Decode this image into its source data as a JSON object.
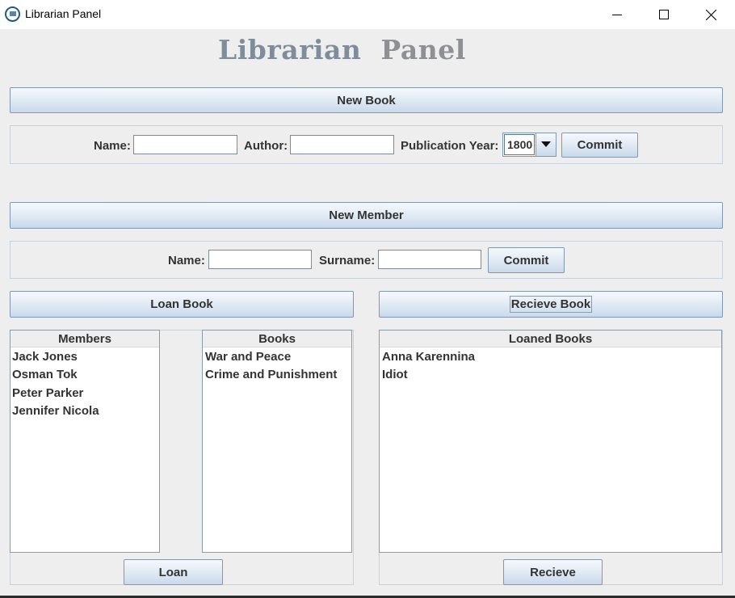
{
  "window": {
    "title": "Librarian Panel",
    "icon": "library-app-icon",
    "icon_text": "IIII"
  },
  "heading": {
    "word1": "Librarian",
    "word2": "Panel"
  },
  "new_book": {
    "section_label": "New Book",
    "name_label": "Name:",
    "name_value": "",
    "author_label": "Author:",
    "author_value": "",
    "year_label": "Publication Year:",
    "year_selected": "1800",
    "commit_label": "Commit"
  },
  "new_member": {
    "section_label": "New Member",
    "name_label": "Name:",
    "name_value": "",
    "surname_label": "Surname:",
    "surname_value": "",
    "commit_label": "Commit"
  },
  "loan_book": {
    "section_label": "Loan Book",
    "members_header": "Members",
    "members": [
      "Jack Jones",
      "Osman Tok",
      "Peter Parker",
      "Jennifer Nicola"
    ],
    "books_header": "Books",
    "books": [
      "War and Peace",
      "Crime and Punishment"
    ],
    "loan_label": "Loan"
  },
  "receive_book": {
    "section_label": "Recieve Book",
    "loaned_header": "Loaned Books",
    "loaned": [
      "Anna Karennina",
      "Idiot"
    ],
    "receive_label": "Recieve"
  },
  "colors": {
    "window_bg": "#eeeeee",
    "button_border": "#7f98b3",
    "heading_word1": "#7f8d9b",
    "heading_word2": "#8e9093"
  }
}
